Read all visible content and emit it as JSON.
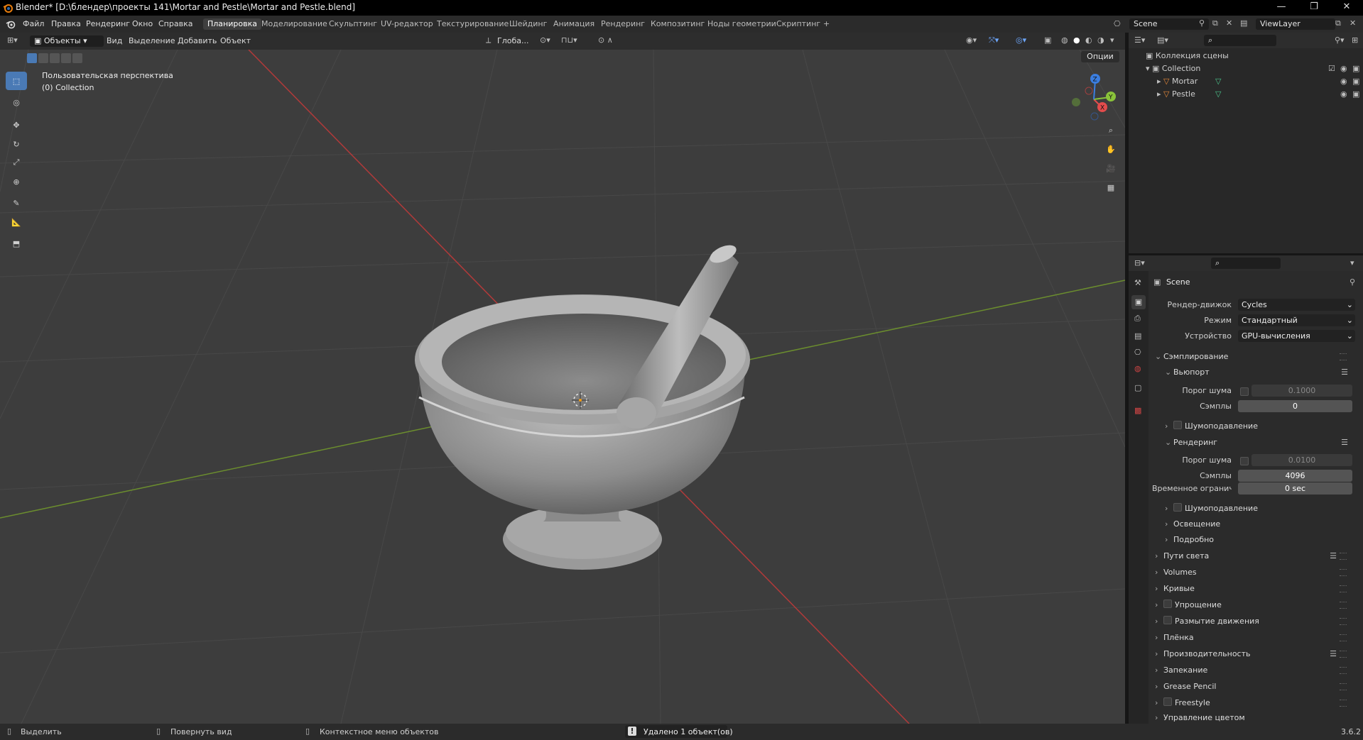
{
  "window": {
    "title": "Blender* [D:\\блендер\\проекты 141\\Mortar and Pestle\\Mortar and Pestle.blend]",
    "min": "—",
    "max": "❐",
    "close": "✕"
  },
  "menu": [
    "Файл",
    "Правка",
    "Рендеринг",
    "Окно",
    "Справка"
  ],
  "workspaces": [
    {
      "label": "Планировка",
      "active": true
    },
    {
      "label": "Моделирование"
    },
    {
      "label": "Скульптинг"
    },
    {
      "label": "UV-редактор"
    },
    {
      "label": "Текстурирование"
    },
    {
      "label": "Шейдинг"
    },
    {
      "label": "Анимация"
    },
    {
      "label": "Рендеринг"
    },
    {
      "label": "Композитинг"
    },
    {
      "label": "Ноды геометрии"
    },
    {
      "label": "Скриптинг"
    }
  ],
  "add_workspace": "+",
  "scene_field": "Scene",
  "viewlayer_field": "ViewLayer",
  "viewport_header": {
    "mode": "Объекты",
    "menus": [
      "Вид",
      "Выделение",
      "Добавить",
      "Объект"
    ],
    "orientation": "Глоба...",
    "options": "Опции"
  },
  "viewport": {
    "view_name": "Пользовательская перспектива",
    "collection": "(0) Collection",
    "gizmo": {
      "x": "X",
      "y": "Y",
      "z": "Z"
    }
  },
  "outliner": {
    "root": "Коллекция сцены",
    "collection": "Collection",
    "items": [
      "Mortar",
      "Pestle"
    ]
  },
  "properties": {
    "scene": "Scene",
    "render_engine_label": "Рендер-движок",
    "render_engine": "Cycles",
    "mode_label": "Режим",
    "mode": "Стандартный",
    "device_label": "Устройство",
    "device": "GPU-вычисления",
    "sampling": "Сэмплирование",
    "viewport": "Вьюпорт",
    "noise_threshold_label": "Порог шума",
    "vp_noise_threshold": "0.1000",
    "samples_label": "Сэмплы",
    "vp_samples": "0",
    "denoise": "Шумоподавление",
    "render": "Рендеринг",
    "r_noise_threshold": "0.0100",
    "r_samples": "4096",
    "time_limit_label": "Временное огранич...",
    "time_limit": "0 sec",
    "r_denoise": "Шумоподавление",
    "lighting": "Освещение",
    "advanced": "Подробно",
    "sections": [
      {
        "label": "Пути света",
        "list": true
      },
      {
        "label": "Volumes"
      },
      {
        "label": "Кривые"
      },
      {
        "label": "Упрощение",
        "check": true
      },
      {
        "label": "Размытие движения",
        "check": true
      },
      {
        "label": "Плёнка"
      },
      {
        "label": "Производительность",
        "list": true
      },
      {
        "label": "Запекание"
      },
      {
        "label": "Grease Pencil"
      },
      {
        "label": "Freestyle",
        "check": true
      },
      {
        "label": "Управление цветом"
      }
    ]
  },
  "status": {
    "select": "Выделить",
    "rotate": "Повернуть вид",
    "context": "Контекстное меню объектов",
    "message": "Удалено 1 объект(ов)",
    "version": "3.6.2"
  }
}
